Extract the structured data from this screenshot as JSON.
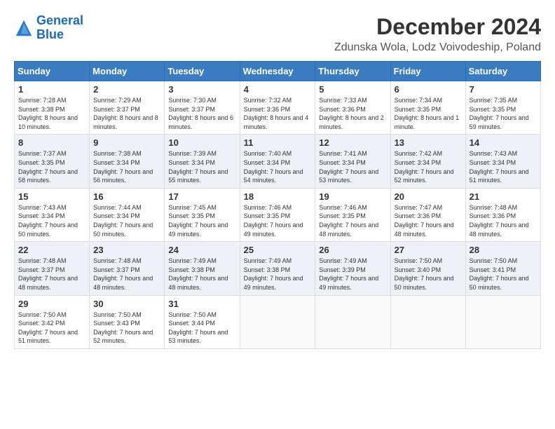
{
  "header": {
    "logo_line1": "General",
    "logo_line2": "Blue",
    "main_title": "December 2024",
    "subtitle": "Zdunska Wola, Lodz Voivodeship, Poland"
  },
  "weekdays": [
    "Sunday",
    "Monday",
    "Tuesday",
    "Wednesday",
    "Thursday",
    "Friday",
    "Saturday"
  ],
  "weeks": [
    [
      {
        "day": "1",
        "sunrise": "Sunrise: 7:28 AM",
        "sunset": "Sunset: 3:38 PM",
        "daylight": "Daylight: 8 hours and 10 minutes."
      },
      {
        "day": "2",
        "sunrise": "Sunrise: 7:29 AM",
        "sunset": "Sunset: 3:37 PM",
        "daylight": "Daylight: 8 hours and 8 minutes."
      },
      {
        "day": "3",
        "sunrise": "Sunrise: 7:30 AM",
        "sunset": "Sunset: 3:37 PM",
        "daylight": "Daylight: 8 hours and 6 minutes."
      },
      {
        "day": "4",
        "sunrise": "Sunrise: 7:32 AM",
        "sunset": "Sunset: 3:36 PM",
        "daylight": "Daylight: 8 hours and 4 minutes."
      },
      {
        "day": "5",
        "sunrise": "Sunrise: 7:33 AM",
        "sunset": "Sunset: 3:36 PM",
        "daylight": "Daylight: 8 hours and 2 minutes."
      },
      {
        "day": "6",
        "sunrise": "Sunrise: 7:34 AM",
        "sunset": "Sunset: 3:35 PM",
        "daylight": "Daylight: 8 hours and 1 minute."
      },
      {
        "day": "7",
        "sunrise": "Sunrise: 7:35 AM",
        "sunset": "Sunset: 3:35 PM",
        "daylight": "Daylight: 7 hours and 59 minutes."
      }
    ],
    [
      {
        "day": "8",
        "sunrise": "Sunrise: 7:37 AM",
        "sunset": "Sunset: 3:35 PM",
        "daylight": "Daylight: 7 hours and 58 minutes."
      },
      {
        "day": "9",
        "sunrise": "Sunrise: 7:38 AM",
        "sunset": "Sunset: 3:34 PM",
        "daylight": "Daylight: 7 hours and 56 minutes."
      },
      {
        "day": "10",
        "sunrise": "Sunrise: 7:39 AM",
        "sunset": "Sunset: 3:34 PM",
        "daylight": "Daylight: 7 hours and 55 minutes."
      },
      {
        "day": "11",
        "sunrise": "Sunrise: 7:40 AM",
        "sunset": "Sunset: 3:34 PM",
        "daylight": "Daylight: 7 hours and 54 minutes."
      },
      {
        "day": "12",
        "sunrise": "Sunrise: 7:41 AM",
        "sunset": "Sunset: 3:34 PM",
        "daylight": "Daylight: 7 hours and 53 minutes."
      },
      {
        "day": "13",
        "sunrise": "Sunrise: 7:42 AM",
        "sunset": "Sunset: 3:34 PM",
        "daylight": "Daylight: 7 hours and 52 minutes."
      },
      {
        "day": "14",
        "sunrise": "Sunrise: 7:43 AM",
        "sunset": "Sunset: 3:34 PM",
        "daylight": "Daylight: 7 hours and 51 minutes."
      }
    ],
    [
      {
        "day": "15",
        "sunrise": "Sunrise: 7:43 AM",
        "sunset": "Sunset: 3:34 PM",
        "daylight": "Daylight: 7 hours and 50 minutes."
      },
      {
        "day": "16",
        "sunrise": "Sunrise: 7:44 AM",
        "sunset": "Sunset: 3:34 PM",
        "daylight": "Daylight: 7 hours and 50 minutes."
      },
      {
        "day": "17",
        "sunrise": "Sunrise: 7:45 AM",
        "sunset": "Sunset: 3:35 PM",
        "daylight": "Daylight: 7 hours and 49 minutes."
      },
      {
        "day": "18",
        "sunrise": "Sunrise: 7:46 AM",
        "sunset": "Sunset: 3:35 PM",
        "daylight": "Daylight: 7 hours and 49 minutes."
      },
      {
        "day": "19",
        "sunrise": "Sunrise: 7:46 AM",
        "sunset": "Sunset: 3:35 PM",
        "daylight": "Daylight: 7 hours and 48 minutes."
      },
      {
        "day": "20",
        "sunrise": "Sunrise: 7:47 AM",
        "sunset": "Sunset: 3:36 PM",
        "daylight": "Daylight: 7 hours and 48 minutes."
      },
      {
        "day": "21",
        "sunrise": "Sunrise: 7:48 AM",
        "sunset": "Sunset: 3:36 PM",
        "daylight": "Daylight: 7 hours and 48 minutes."
      }
    ],
    [
      {
        "day": "22",
        "sunrise": "Sunrise: 7:48 AM",
        "sunset": "Sunset: 3:37 PM",
        "daylight": "Daylight: 7 hours and 48 minutes."
      },
      {
        "day": "23",
        "sunrise": "Sunrise: 7:48 AM",
        "sunset": "Sunset: 3:37 PM",
        "daylight": "Daylight: 7 hours and 48 minutes."
      },
      {
        "day": "24",
        "sunrise": "Sunrise: 7:49 AM",
        "sunset": "Sunset: 3:38 PM",
        "daylight": "Daylight: 7 hours and 48 minutes."
      },
      {
        "day": "25",
        "sunrise": "Sunrise: 7:49 AM",
        "sunset": "Sunset: 3:38 PM",
        "daylight": "Daylight: 7 hours and 49 minutes."
      },
      {
        "day": "26",
        "sunrise": "Sunrise: 7:49 AM",
        "sunset": "Sunset: 3:39 PM",
        "daylight": "Daylight: 7 hours and 49 minutes."
      },
      {
        "day": "27",
        "sunrise": "Sunrise: 7:50 AM",
        "sunset": "Sunset: 3:40 PM",
        "daylight": "Daylight: 7 hours and 50 minutes."
      },
      {
        "day": "28",
        "sunrise": "Sunrise: 7:50 AM",
        "sunset": "Sunset: 3:41 PM",
        "daylight": "Daylight: 7 hours and 50 minutes."
      }
    ],
    [
      {
        "day": "29",
        "sunrise": "Sunrise: 7:50 AM",
        "sunset": "Sunset: 3:42 PM",
        "daylight": "Daylight: 7 hours and 51 minutes."
      },
      {
        "day": "30",
        "sunrise": "Sunrise: 7:50 AM",
        "sunset": "Sunset: 3:43 PM",
        "daylight": "Daylight: 7 hours and 52 minutes."
      },
      {
        "day": "31",
        "sunrise": "Sunrise: 7:50 AM",
        "sunset": "Sunset: 3:44 PM",
        "daylight": "Daylight: 7 hours and 53 minutes."
      },
      null,
      null,
      null,
      null
    ]
  ]
}
